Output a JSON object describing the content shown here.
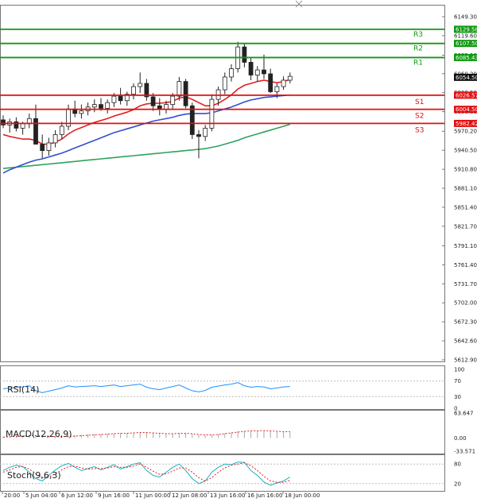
{
  "chart_data": {
    "type": "candlestick",
    "main": {
      "ylim": [
        5612.9,
        6149.3
      ],
      "y_ticks": [
        "6149.30",
        "6119.60",
        "6089.10",
        "6060.20",
        "6030.50",
        "6000.80",
        "5970.20",
        "5940.50",
        "5910.80",
        "5881.10",
        "5851.40",
        "5821.70",
        "5791.10",
        "5761.40",
        "5731.70",
        "5702.00",
        "5672.30",
        "5642.60",
        "5612.90"
      ],
      "current_price": "6054.50",
      "candles": [
        {
          "o": 5988,
          "h": 5995,
          "l": 5975,
          "c": 5980
        },
        {
          "o": 5980,
          "h": 5990,
          "l": 5968,
          "c": 5985
        },
        {
          "o": 5985,
          "h": 5992,
          "l": 5970,
          "c": 5975
        },
        {
          "o": 5975,
          "h": 5985,
          "l": 5965,
          "c": 5982
        },
        {
          "o": 5982,
          "h": 5998,
          "l": 5975,
          "c": 5990
        },
        {
          "o": 5990,
          "h": 6012,
          "l": 5960,
          "c": 5950
        },
        {
          "o": 5950,
          "h": 5965,
          "l": 5928,
          "c": 5940
        },
        {
          "o": 5940,
          "h": 5960,
          "l": 5932,
          "c": 5952
        },
        {
          "o": 5952,
          "h": 5972,
          "l": 5945,
          "c": 5965
        },
        {
          "o": 5965,
          "h": 5985,
          "l": 5958,
          "c": 5978
        },
        {
          "o": 5978,
          "h": 6012,
          "l": 5972,
          "c": 6005
        },
        {
          "o": 6005,
          "h": 6018,
          "l": 5992,
          "c": 5998
        },
        {
          "o": 5998,
          "h": 6012,
          "l": 5990,
          "c": 6002
        },
        {
          "o": 6002,
          "h": 6015,
          "l": 5995,
          "c": 6008
        },
        {
          "o": 6008,
          "h": 6020,
          "l": 6000,
          "c": 6012
        },
        {
          "o": 6012,
          "h": 6022,
          "l": 6002,
          "c": 6006
        },
        {
          "o": 6006,
          "h": 6020,
          "l": 5998,
          "c": 6015
        },
        {
          "o": 6015,
          "h": 6030,
          "l": 6008,
          "c": 6025
        },
        {
          "o": 6025,
          "h": 6038,
          "l": 6012,
          "c": 6018
        },
        {
          "o": 6018,
          "h": 6032,
          "l": 6010,
          "c": 6028
        },
        {
          "o": 6028,
          "h": 6045,
          "l": 6020,
          "c": 6040
        },
        {
          "o": 6040,
          "h": 6062,
          "l": 6030,
          "c": 6045
        },
        {
          "o": 6045,
          "h": 6052,
          "l": 6018,
          "c": 6024
        },
        {
          "o": 6024,
          "h": 6030,
          "l": 6002,
          "c": 6010
        },
        {
          "o": 6010,
          "h": 6022,
          "l": 5995,
          "c": 6004
        },
        {
          "o": 6004,
          "h": 6018,
          "l": 5998,
          "c": 6012
        },
        {
          "o": 6012,
          "h": 6030,
          "l": 6005,
          "c": 6025
        },
        {
          "o": 6025,
          "h": 6055,
          "l": 6018,
          "c": 6048
        },
        {
          "o": 6048,
          "h": 6052,
          "l": 6006,
          "c": 6010
        },
        {
          "o": 6010,
          "h": 6015,
          "l": 5958,
          "c": 5965
        },
        {
          "o": 5965,
          "h": 5972,
          "l": 5928,
          "c": 5962
        },
        {
          "o": 5962,
          "h": 5980,
          "l": 5955,
          "c": 5975
        },
        {
          "o": 5975,
          "h": 6028,
          "l": 5970,
          "c": 6020
        },
        {
          "o": 6020,
          "h": 6040,
          "l": 6010,
          "c": 6035
        },
        {
          "o": 6035,
          "h": 6062,
          "l": 6028,
          "c": 6055
        },
        {
          "o": 6055,
          "h": 6075,
          "l": 6048,
          "c": 6068
        },
        {
          "o": 6068,
          "h": 6110,
          "l": 6062,
          "c": 6102
        },
        {
          "o": 6102,
          "h": 6108,
          "l": 6070,
          "c": 6078
        },
        {
          "o": 6078,
          "h": 6086,
          "l": 6050,
          "c": 6058
        },
        {
          "o": 6058,
          "h": 6072,
          "l": 6048,
          "c": 6066
        },
        {
          "o": 6066,
          "h": 6090,
          "l": 6052,
          "c": 6060
        },
        {
          "o": 6060,
          "h": 6068,
          "l": 6030,
          "c": 6032
        },
        {
          "o": 6032,
          "h": 6045,
          "l": 6022,
          "c": 6040
        },
        {
          "o": 6040,
          "h": 6056,
          "l": 6035,
          "c": 6050
        },
        {
          "o": 6050,
          "h": 6062,
          "l": 6045,
          "c": 6056
        }
      ],
      "ma_fast": [
        5965,
        5962,
        5960,
        5958,
        5958,
        5956,
        5950,
        5950,
        5953,
        5958,
        5966,
        5972,
        5976,
        5980,
        5984,
        5987,
        5990,
        5994,
        5997,
        6000,
        6004,
        6010,
        6013,
        6014,
        6014,
        6015,
        6017,
        6022,
        6024,
        6020,
        6015,
        6010,
        6010,
        6014,
        6020,
        6027,
        6036,
        6042,
        6045,
        6048,
        6050,
        6048,
        6046,
        6048,
        6051
      ],
      "ma_mid": [
        5905,
        5910,
        5914,
        5918,
        5922,
        5925,
        5927,
        5930,
        5933,
        5936,
        5940,
        5944,
        5948,
        5952,
        5956,
        5960,
        5964,
        5968,
        5971,
        5974,
        5977,
        5980,
        5983,
        5986,
        5988,
        5990,
        5992,
        5995,
        5997,
        5998,
        5998,
        5998,
        5999,
        6002,
        6005,
        6008,
        6012,
        6016,
        6019,
        6021,
        6023,
        6024,
        6025,
        6026,
        6027
      ],
      "ma_slow": [
        5912,
        5913,
        5914,
        5915,
        5916,
        5917,
        5918,
        5919,
        5920,
        5921,
        5922,
        5923,
        5924,
        5925,
        5926,
        5927,
        5928,
        5929,
        5930,
        5931,
        5932,
        5933,
        5934,
        5935,
        5936,
        5937,
        5938,
        5939,
        5940,
        5941,
        5942,
        5943,
        5945,
        5947,
        5950,
        5953,
        5956,
        5960,
        5963,
        5966,
        5969,
        5972,
        5975,
        5978,
        5981
      ]
    },
    "levels": [
      {
        "label": "R3",
        "price": "6129.58",
        "value": 6129.58,
        "color": "#119911"
      },
      {
        "label": "R2",
        "price": "6107.50",
        "value": 6107.5,
        "color": "#119911"
      },
      {
        "label": "R1",
        "price": "6085.43",
        "value": 6085.43,
        "color": "#119911"
      },
      {
        "label": "S1",
        "price": "6026.57",
        "value": 6026.57,
        "color": "#e01010"
      },
      {
        "label": "S2",
        "price": "6004.50",
        "value": 6004.5,
        "color": "#e01010"
      },
      {
        "label": "S3",
        "price": "5982.42",
        "value": 5982.42,
        "color": "#e01010"
      }
    ],
    "x_labels": [
      "20:00",
      "5 Jun 04:00",
      "6 Jun 12:00",
      "9 Jun 16:00",
      "11 Jun 00:00",
      "12 Jun 08:00",
      "13 Jun 16:00",
      "16 Jun 16:00",
      "18 Jun 00:00"
    ],
    "rsi": {
      "label": "RSI(14)",
      "ticks": [
        "100",
        "70",
        "30",
        "0"
      ],
      "values": [
        50,
        52,
        54,
        55,
        58,
        45,
        40,
        44,
        48,
        52,
        58,
        55,
        56,
        57,
        58,
        56,
        58,
        60,
        56,
        58,
        60,
        62,
        54,
        50,
        48,
        52,
        56,
        60,
        52,
        45,
        42,
        46,
        54,
        57,
        60,
        62,
        66,
        58,
        54,
        56,
        55,
        50,
        52,
        55,
        56
      ]
    },
    "macd": {
      "label": "MACD(12,26,9)",
      "ticks": [
        "63.647",
        "0.00",
        "-33.571"
      ],
      "hist": [
        4,
        4,
        5,
        6,
        7,
        6,
        4,
        3,
        3,
        4,
        6,
        7,
        8,
        9,
        10,
        10,
        11,
        12,
        12,
        13,
        14,
        15,
        14,
        12,
        11,
        11,
        12,
        13,
        12,
        10,
        8,
        7,
        8,
        10,
        12,
        14,
        17,
        18,
        18,
        19,
        19,
        17,
        16,
        16,
        16
      ],
      "signal": [
        2,
        3,
        4,
        5,
        6,
        6,
        5,
        4,
        3,
        3,
        4,
        5,
        6,
        7,
        8,
        9,
        10,
        11,
        12,
        12,
        13,
        14,
        14,
        13,
        12,
        11,
        11,
        12,
        12,
        11,
        9,
        8,
        8,
        9,
        11,
        13,
        15,
        17,
        18,
        18,
        19,
        18,
        17,
        16,
        16
      ]
    },
    "stoch": {
      "label": "Stoch(9,6,3)",
      "ticks": [
        "80",
        "20"
      ],
      "main": [
        60,
        70,
        76,
        72,
        55,
        35,
        28,
        45,
        62,
        75,
        82,
        70,
        60,
        66,
        72,
        62,
        70,
        78,
        65,
        72,
        80,
        84,
        60,
        45,
        40,
        55,
        70,
        80,
        60,
        35,
        20,
        28,
        55,
        70,
        80,
        78,
        86,
        85,
        60,
        45,
        25,
        15,
        22,
        28,
        40
      ],
      "signal": [
        55,
        62,
        70,
        72,
        65,
        50,
        38,
        40,
        50,
        62,
        72,
        74,
        68,
        64,
        66,
        66,
        68,
        72,
        70,
        70,
        74,
        80,
        70,
        58,
        48,
        50,
        58,
        68,
        68,
        55,
        38,
        28,
        38,
        55,
        68,
        76,
        80,
        84,
        75,
        60,
        42,
        28,
        24,
        24,
        30
      ]
    }
  }
}
